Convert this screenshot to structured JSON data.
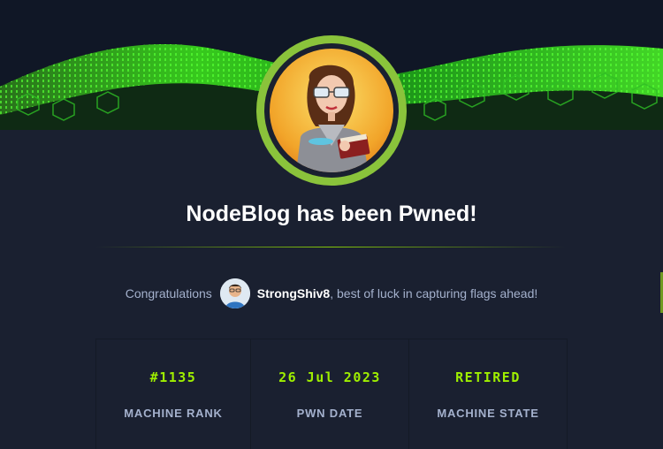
{
  "title": "NodeBlog has been Pwned!",
  "congrats": {
    "prefix": "Congratulations",
    "username": "StrongShiv8",
    "suffix": ", best of luck in capturing flags ahead!"
  },
  "stats": [
    {
      "value": "#1135",
      "label": "MACHINE RANK"
    },
    {
      "value": "26 Jul 2023",
      "label": "PWN DATE"
    },
    {
      "value": "RETIRED",
      "label": "MACHINE STATE"
    }
  ],
  "colors": {
    "accent": "#9fef00",
    "ring": "#8ac33b",
    "background": "#1a2030",
    "label": "#a4b1cd"
  },
  "icons": {
    "banner": "green-matrix-cube-wave-banner",
    "machine_avatar": "woman-with-glasses-and-book-avatar",
    "user_avatar": "user-avatar-icon"
  }
}
